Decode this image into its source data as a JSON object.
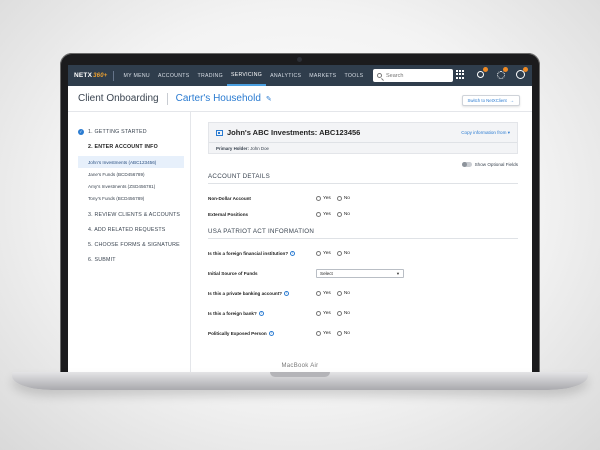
{
  "device": {
    "brand_text": "MacBook Air"
  },
  "nav": {
    "logo": "NETX",
    "logo_badge": "360+",
    "items": [
      "MY MENU",
      "ACCOUNTS",
      "TRADING",
      "SERVICING",
      "ANALYTICS",
      "MARKETS",
      "TOOLS"
    ],
    "active_item": "SERVICING",
    "search_placeholder": "Search",
    "icons": [
      "grid-icon",
      "bell-icon",
      "gear-icon",
      "user-icon"
    ],
    "colors": {
      "bar": "#2f3d4c",
      "active_underline": "#4a9fe0",
      "badge": "#f08a24"
    }
  },
  "header": {
    "title": "Client Onboarding",
    "household": "Carter's Household",
    "switch_label": "Switch to NetXClient"
  },
  "sidebar": {
    "steps": [
      {
        "label": "1. GETTING STARTED",
        "completed": true
      },
      {
        "label": "2. ENTER ACCOUNT INFO",
        "active": true
      },
      {
        "label": "3. REVIEW CLIENTS & ACCOUNTS"
      },
      {
        "label": "4. ADD RELATED REQUESTS"
      },
      {
        "label": "5. CHOOSE FORMS & SIGNATURE"
      },
      {
        "label": "6. SUBMIT"
      }
    ],
    "accounts": [
      "John's Investments (ABC123456)",
      "Jane's Funds (BCD456789)",
      "Amy's Investments (ZSD456781)",
      "Tony's Funds (BCD456789)"
    ]
  },
  "main": {
    "account_title": "John's ABC Investments: ABC123456",
    "copy_from": "Copy information from",
    "primary_holder_label": "Primary Holder:",
    "primary_holder_value": "John Doe",
    "optional_toggle": "Show Optional Fields",
    "account_details": {
      "title": "ACCOUNT DETAILS",
      "rows": [
        "Non-Dollar Account",
        "External Positions"
      ]
    },
    "patriot": {
      "title": "USA PATRIOT ACT INFORMATION",
      "q1": "Is this a foreign financial institution?",
      "q2": "Initial Source of Funds",
      "q2_select": "Select",
      "q3": "Is this a private banking account?",
      "q4": "Is this a foreign bank?",
      "q5": "Politically Exposed Person"
    },
    "yes": "Yes",
    "no": "No"
  }
}
